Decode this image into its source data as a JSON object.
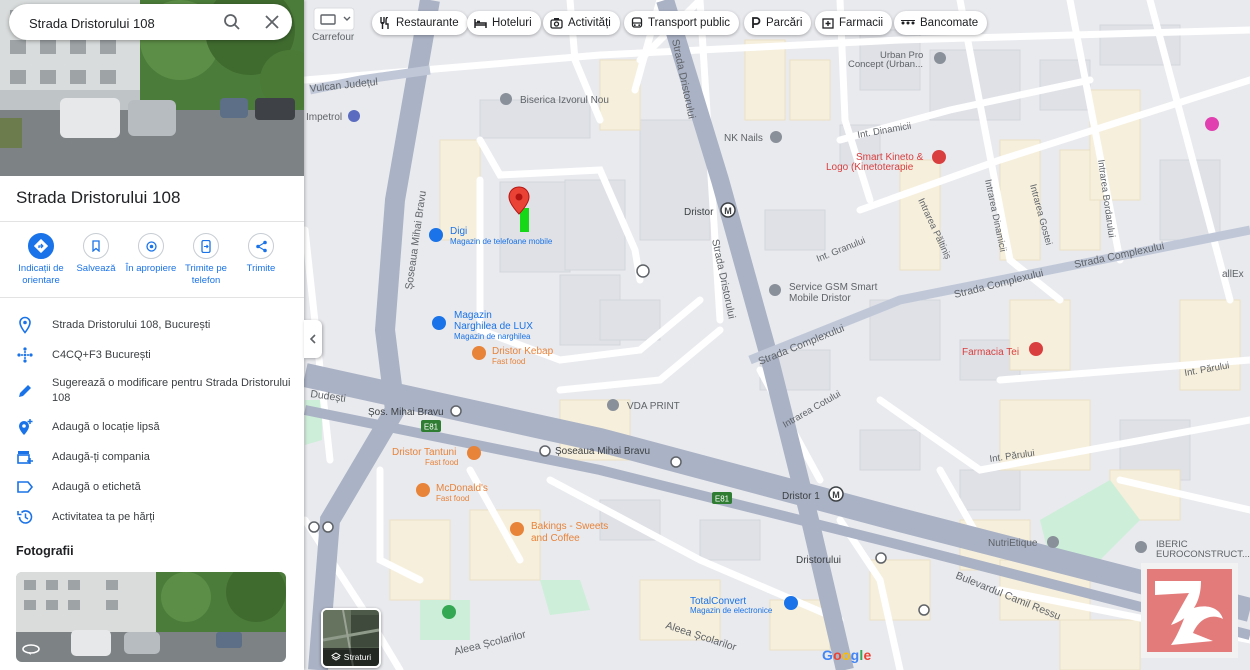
{
  "search": {
    "value": "Strada Dristorului 108"
  },
  "place": {
    "title": "Strada Dristorului 108"
  },
  "actions": [
    {
      "label": "Indicații de orientare",
      "icon": "directions-icon"
    },
    {
      "label": "Salvează",
      "icon": "bookmark-icon"
    },
    {
      "label": "În apropiere",
      "icon": "nearby-icon"
    },
    {
      "label": "Trimite pe telefon",
      "icon": "send-to-phone-icon"
    },
    {
      "label": "Trimite",
      "icon": "share-icon"
    }
  ],
  "info": [
    {
      "text": "Strada Dristorului 108, București",
      "icon": "location-pin-icon"
    },
    {
      "text": "C4CQ+F3 București",
      "icon": "plus-code-icon"
    },
    {
      "text": "Sugerează o modificare pentru Strada Dristorului 108",
      "icon": "edit-pencil-icon"
    },
    {
      "text": "Adaugă o locație lipsă",
      "icon": "add-location-icon"
    },
    {
      "text": "Adaugă-ți compania",
      "icon": "add-business-icon"
    },
    {
      "text": "Adaugă o etichetă",
      "icon": "label-icon"
    },
    {
      "text": "Activitatea ta pe hărți",
      "icon": "history-icon"
    }
  ],
  "photos_label": "Fotografii",
  "chips": [
    {
      "label": "Restaurante",
      "icon": "fork-knife-icon"
    },
    {
      "label": "Hoteluri",
      "icon": "bed-icon"
    },
    {
      "label": "Activități",
      "icon": "camera-icon"
    },
    {
      "label": "Transport public",
      "icon": "bus-icon"
    },
    {
      "label": "Parcări",
      "icon": "parking-icon"
    },
    {
      "label": "Farmacii",
      "icon": "pharmacy-icon"
    },
    {
      "label": "Bancomate",
      "icon": "atm-icon"
    }
  ],
  "layers_label": "Straturi",
  "map": {
    "streets": {
      "mihai_bravu": "Șoseaua Mihai Bravu",
      "dristorului": "Strada Dristorului",
      "complexului": "Strada Complexului",
      "complexului2": "Strada Complexului",
      "camil_ressu": "Bulevardul Camil Ressu",
      "scolarilor": "Aleea Școlarilor",
      "scolarilor2": "Aleea Școlarilor",
      "vulcan": "Vulcan Județul",
      "dudesti": "Dudești",
      "dinamici": "Int. Dinamicii",
      "granului": "Int. Granului",
      "parului": "Int. Părului",
      "parului2": "Int. Părului",
      "cotului": "Intrarea Cotului",
      "gostei": "Intrarea Gostei",
      "bordarului": "Intrarea Bordarului",
      "dinamicii2": "Intrarea Dinamicii",
      "paltinis": "Intrarea Păltiniș",
      "e81": "E81",
      "e81b": "E81",
      "mihai_bravu_stop": "Șos. Mihai Bravu",
      "sos_mihai_bravu2": "Șoseaua Mihai Bravu",
      "dristorului_stop": "Dristorului",
      "allex": "allEx",
      "carrefour": "Carrefour"
    },
    "pois": {
      "biserica": "Biserica Izvorul Nou",
      "nk_nails": "NK Nails",
      "smart_kineto": "Smart Kineto &",
      "smart_kineto2": "Logo (Kinetoterapie",
      "dristor_metro": "Dristor",
      "digi": "Digi",
      "digi_sub": "Magazin de telefoane mobile",
      "narghilea": "Magazin",
      "narghilea2": "Narghilea de LUX",
      "narghilea_sub": "Magazin de narghilea",
      "kebap": "Dristor Kebap",
      "kebap_sub": "Fast food",
      "vda": "VDA PRINT",
      "gsm": "Service GSM Smart",
      "gsm2": "Mobile Dristor",
      "farmacia": "Farmacia Tei",
      "dristor1": "Dristor 1",
      "tantuni": "Dristor Tantuni",
      "tantuni_sub": "Fast food",
      "mcdonalds": "McDonald's",
      "mcdonalds_sub": "Fast food",
      "bakings": "Bakings - Sweets",
      "bakings2": "and Coffee",
      "nutrietique": "NutriEtique",
      "iberic": "IBERIC",
      "iberic2": "EUROCONSTRUCT...",
      "totalconvert": "TotalConvert",
      "totalconvert_sub": "Magazin de electronice",
      "urban": "Urban Pro",
      "urban2": "Concept (Urban...",
      "impetrol": "Impetrol"
    }
  },
  "google_logo": "Google"
}
